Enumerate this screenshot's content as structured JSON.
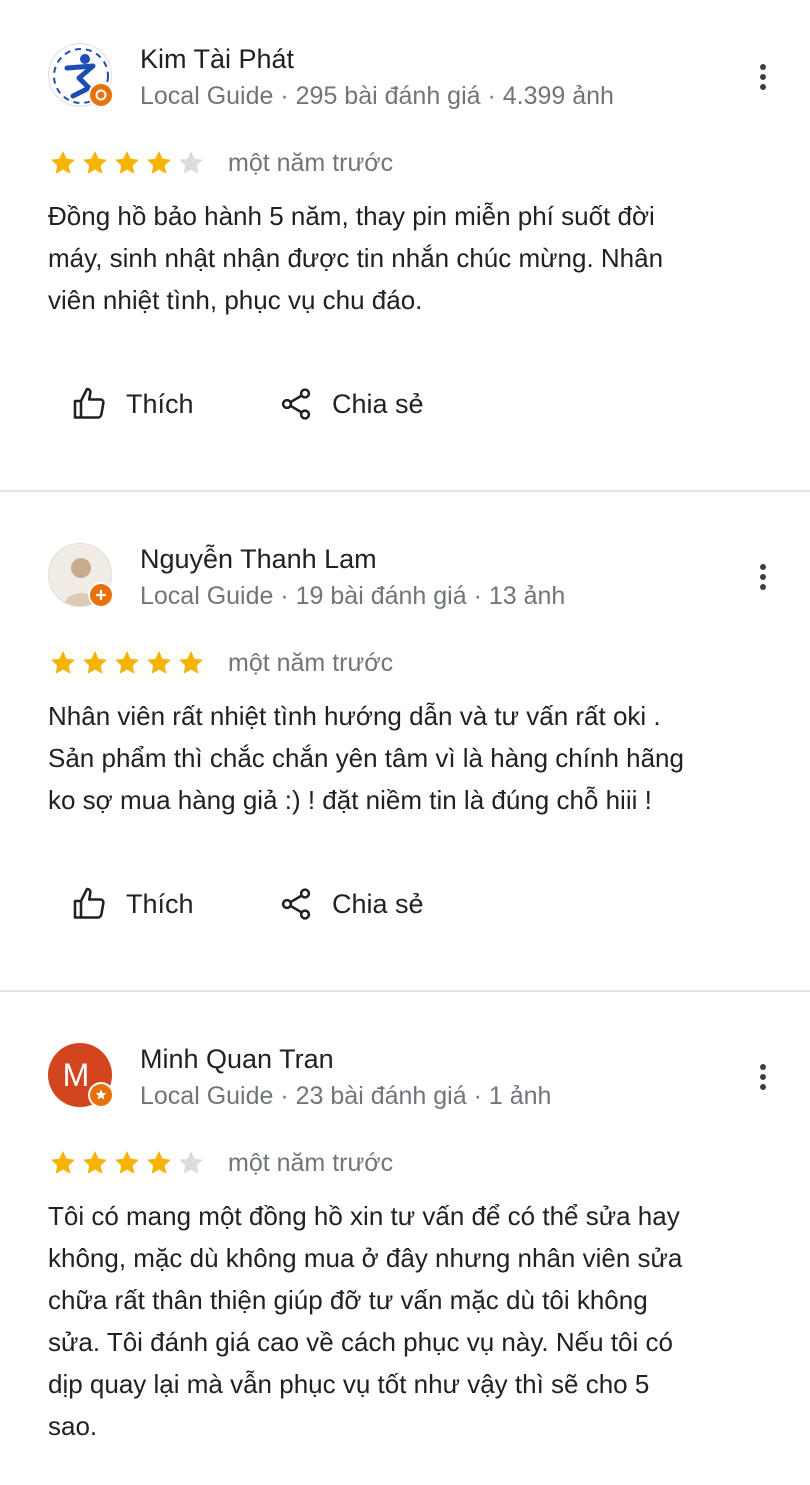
{
  "colors": {
    "star_filled": "#f4b400",
    "star_empty": "#dadce0",
    "meta_text": "#70757a",
    "badge": "#e8710a",
    "avatar_m": "#d2451e"
  },
  "reviews": [
    {
      "name": "Kim Tài Phát",
      "meta": "Local Guide · 295 bài đánh giá · 4.399 ảnh",
      "rating": 4,
      "date": "một năm trước",
      "text": "Đồng hồ bảo hành 5 năm, thay pin miễn phí suốt đời\nmáy, sinh nhật nhận được tin nhắn chúc mừng. Nhân\nviên nhiệt tình, phục vụ chu đáo.",
      "like_label": "Thích",
      "share_label": "Chia sẻ"
    },
    {
      "name": "Nguyễn Thanh Lam",
      "meta": "Local Guide · 19 bài đánh giá · 13 ảnh",
      "rating": 5,
      "date": "một năm trước",
      "text": "Nhân viên rất nhiệt tình hướng dẫn và tư vấn rất oki .\nSản phẩm thì chắc chắn yên tâm vì là hàng chính hãng\nko sợ mua hàng giả :) ! đặt niềm tin là đúng chỗ hiii !",
      "like_label": "Thích",
      "share_label": "Chia sẻ"
    },
    {
      "name": "Minh Quan Tran",
      "meta": "Local Guide · 23 bài đánh giá · 1 ảnh",
      "avatar_letter": "M",
      "rating": 4,
      "date": "một năm trước",
      "text": "Tôi có mang một đồng hồ xin tư vấn để có thể sửa hay\nkhông, mặc dù không mua ở đây nhưng nhân viên sửa\nchữa rất thân thiện giúp đỡ tư vấn mặc dù tôi không\nsửa. Tôi đánh giá cao về cách phục vụ này. Nếu tôi có\ndịp quay lại mà vẫn phục vụ tốt như vậy thì sẽ cho 5\nsao."
    }
  ]
}
